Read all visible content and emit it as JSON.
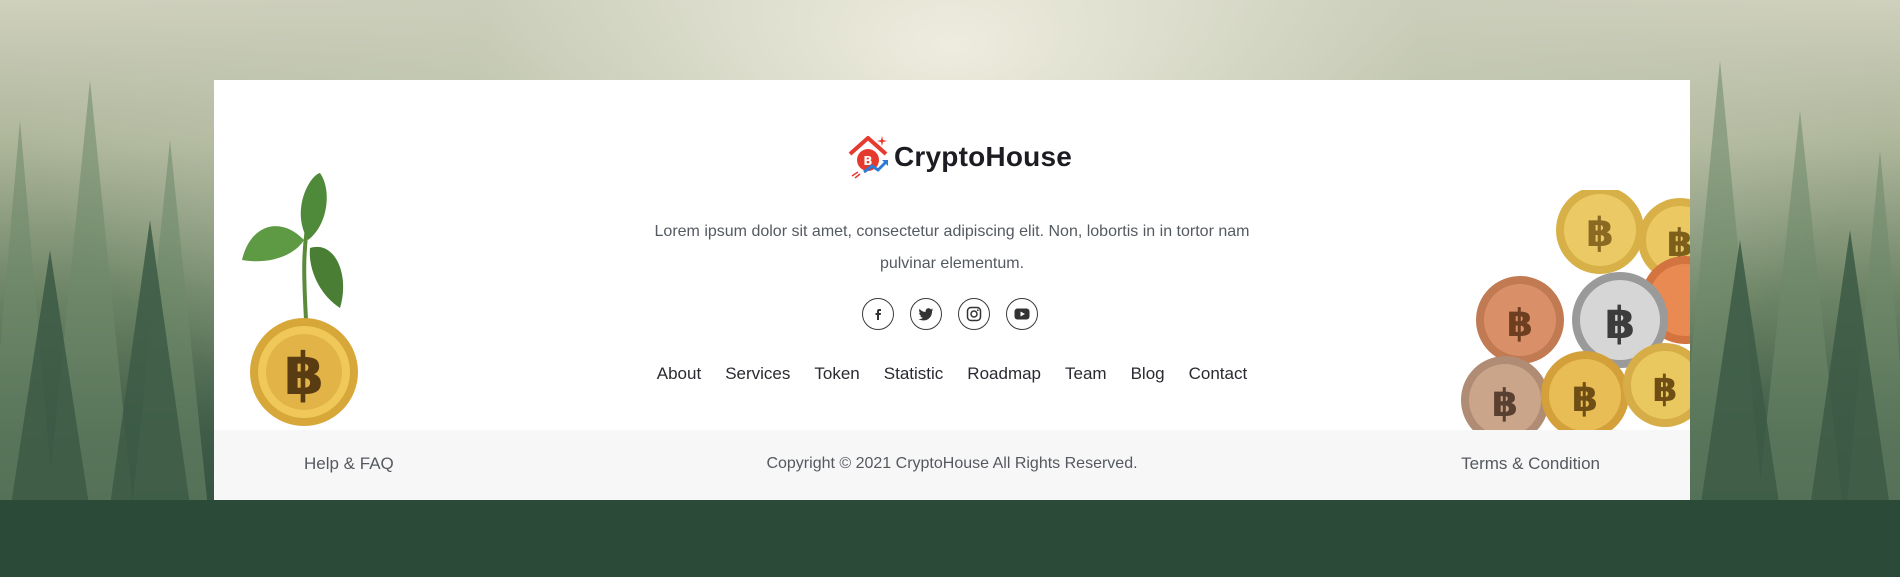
{
  "brand": {
    "name": "CryptoHouse",
    "accent": "#e63a2e",
    "accent2": "#2e7bd6"
  },
  "description": "Lorem ipsum dolor sit amet, consectetur adipiscing elit. Non, lobortis in in tortor nam pulvinar elementum.",
  "social": [
    {
      "icon": "facebook-icon"
    },
    {
      "icon": "twitter-icon"
    },
    {
      "icon": "instagram-icon"
    },
    {
      "icon": "youtube-icon"
    }
  ],
  "nav": [
    "About",
    "Services",
    "Token",
    "Statistic",
    "Roadmap",
    "Team",
    "Blog",
    "Contact"
  ],
  "bottom": {
    "help": "Help & FAQ",
    "copyright": "Copyright © 2021 CryptoHouse All Rights Reserved.",
    "terms": "Terms & Condition"
  },
  "colors": {
    "card_bg": "#ffffff",
    "bottom_bg": "#f7f7f7",
    "text_dark": "#1c1c22"
  }
}
